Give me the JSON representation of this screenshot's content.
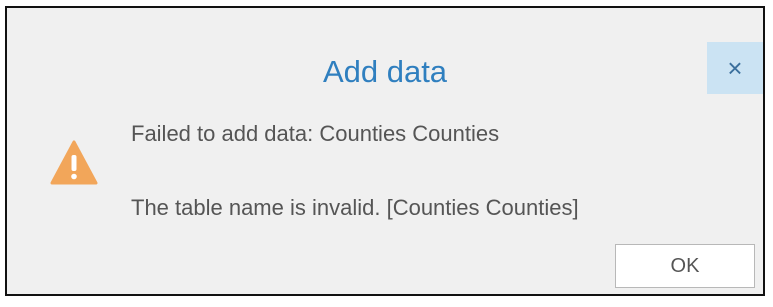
{
  "dialog": {
    "title": "Add data",
    "close_label": "×",
    "message_line1": "Failed to add data: Counties Counties",
    "message_line2": "The table name is invalid. [Counties Counties]",
    "ok_label": "OK",
    "icon": "warning-icon"
  },
  "colors": {
    "title": "#2f7fbf",
    "dialog_bg": "#f0f0f0",
    "close_bg": "#cbe3f3",
    "warning": "#f2a65a",
    "text": "#555555"
  }
}
